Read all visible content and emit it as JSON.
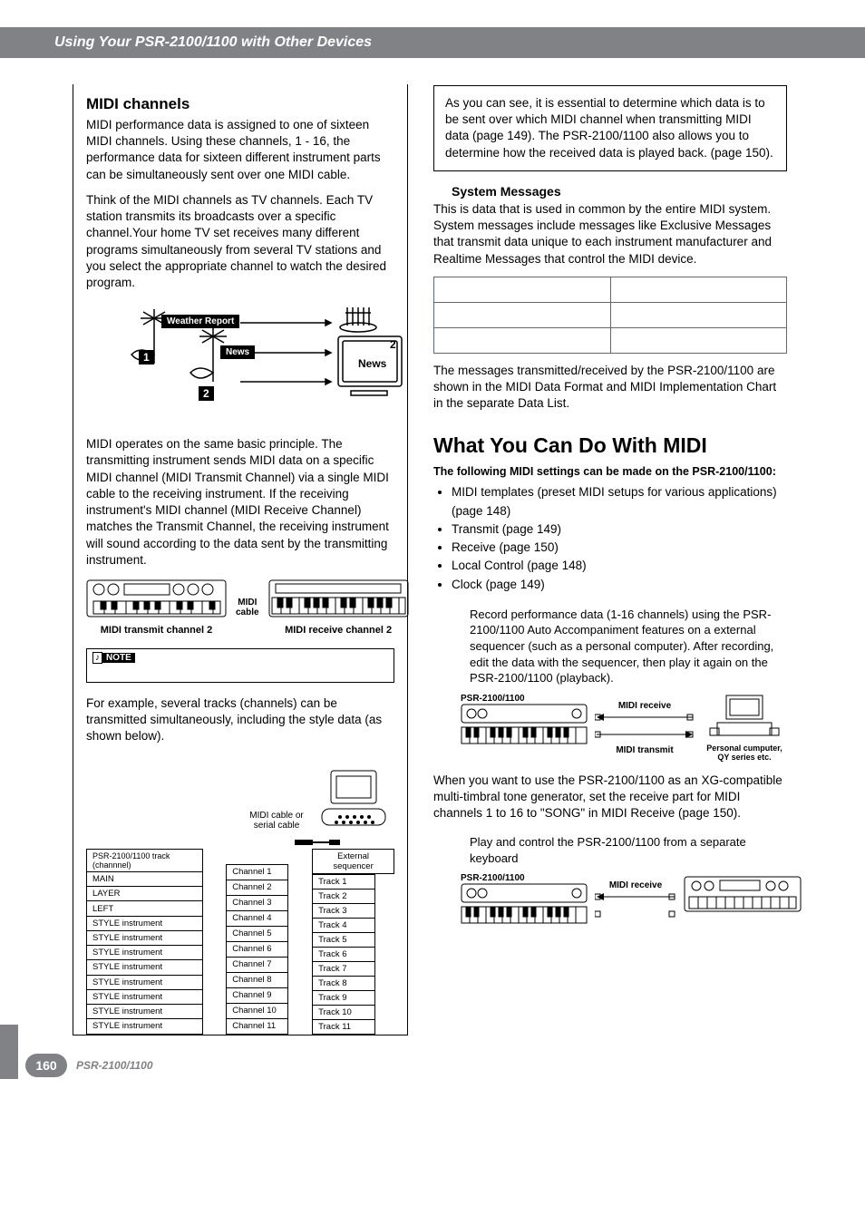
{
  "header": {
    "section_title": "Using Your PSR-2100/1100 with Other Devices"
  },
  "left": {
    "h_midi_channels": "MIDI channels",
    "p1": "MIDI performance data is assigned to one of sixteen MIDI channels. Using these channels, 1 - 16, the performance data for sixteen different instrument parts can be simultaneously sent over one MIDI cable.",
    "p2": "Think of the MIDI channels as TV channels. Each TV station transmits its broadcasts over a specific channel.Your home TV set receives many different programs simultaneously from several TV stations and you select the appropriate channel to watch the desired program.",
    "tv": {
      "weather": "Weather Report",
      "news": "News",
      "n1": "1",
      "n2": "2",
      "n2b": "2",
      "tvnews": "News"
    },
    "p3": "MIDI operates on the same basic principle. The transmitting instrument sends MIDI data on a specific MIDI channel (MIDI Transmit Channel) via a single MIDI cable to the receiving instrument. If the receiving instrument's MIDI channel (MIDI Receive Channel) matches the Transmit Channel, the receiving instrument will sound according to the data sent by the transmitting instrument.",
    "midi_cable": "MIDI\ncable",
    "midi_tx": "MIDI transmit channel 2",
    "midi_rx": "MIDI receive channel 2",
    "note_label": "NOTE",
    "p4": "For example, several tracks (channels) can be transmitted simultaneously, including the style data (as shown below).",
    "track_caption": "MIDI cable or serial cable",
    "track_header": "PSR-2100/1100 track (channnel)",
    "ext_seq": "External sequencer",
    "tracks": [
      {
        "part": "MAIN",
        "ch": "Channel 1",
        "trk": "Track 1"
      },
      {
        "part": "LAYER",
        "ch": "Channel 2",
        "trk": "Track 2"
      },
      {
        "part": "LEFT",
        "ch": "Channel 3",
        "trk": "Track 3"
      },
      {
        "part": "STYLE instrument",
        "ch": "Channel 4",
        "trk": "Track 4"
      },
      {
        "part": "STYLE instrument",
        "ch": "Channel 5",
        "trk": "Track 5"
      },
      {
        "part": "STYLE instrument",
        "ch": "Channel 6",
        "trk": "Track 6"
      },
      {
        "part": "STYLE instrument",
        "ch": "Channel 7",
        "trk": "Track 7"
      },
      {
        "part": "STYLE instrument",
        "ch": "Channel 8",
        "trk": "Track 8"
      },
      {
        "part": "STYLE instrument",
        "ch": "Channel 9",
        "trk": "Track 9"
      },
      {
        "part": "STYLE instrument",
        "ch": "Channel 10",
        "trk": "Track 10"
      },
      {
        "part": "STYLE instrument",
        "ch": "Channel 11",
        "trk": "Track 11"
      }
    ]
  },
  "right": {
    "p_box": "As you can see, it is essential to determine which data is to be sent over which MIDI channel when transmitting MIDI data (page 149). The PSR-2100/1100 also allows you to determine how the received data is played back. (page 150).",
    "h_sys": "System Messages",
    "p_sys": "This is data that is used in common by the entire MIDI system. System messages include messages like Exclusive Messages that transmit data unique to each instrument manufacturer and Realtime Messages that control the MIDI device.",
    "p_after_table": "The messages transmitted/received by the PSR-2100/1100 are shown in the MIDI Data Format and MIDI Implementation Chart in the separate Data List.",
    "h_big": "What You Can Do With MIDI",
    "p_intro": "The following MIDI settings can be made on the PSR-2100/1100:",
    "bullets": [
      "MIDI templates (preset MIDI setups for various applications) (page 148)",
      "Transmit (page 149)",
      "Receive (page 150)",
      "Local Control (page 148)",
      "Clock (page 149)"
    ],
    "p_rec": "Record performance data (1-16 channels) using the PSR-2100/1100 Auto Accompaniment features on a external sequencer (such as a personal computer). After recording, edit the data with the sequencer, then play it again on the PSR-2100/1100 (playback).",
    "d1": {
      "psr": "PSR-2100/1100",
      "mrx": "MIDI receive",
      "mtx": "MIDI transmit",
      "pc": "Personal cumputer, QY series etc."
    },
    "p_xg": "When you want to use the PSR-2100/1100 as an XG-compatible multi-timbral tone generator, set the receive part for MIDI channels 1 to 16 to \"SONG\" in MIDI Receive (page 150).",
    "p_play": "Play and control the PSR-2100/1100 from a separate keyboard",
    "d2": {
      "psr": "PSR-2100/1100",
      "mrx": "MIDI receive"
    }
  },
  "footer": {
    "page": "160",
    "model": "PSR-2100/1100"
  }
}
